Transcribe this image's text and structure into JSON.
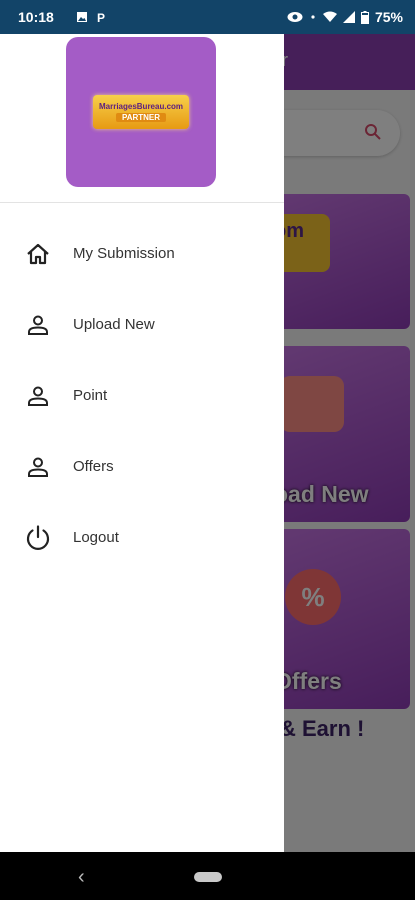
{
  "status_bar": {
    "time": "10:18",
    "battery": "75%"
  },
  "background_app": {
    "header_fragment": "r",
    "cards": [
      {
        "logo_fragment": "om"
      },
      {
        "label_fragment": "oad New"
      },
      {
        "label_fragment": "Offers"
      }
    ],
    "earn_fragment": "& Earn !"
  },
  "drawer": {
    "brand": {
      "line1": "MarriagesBureau.com",
      "line2": "PARTNER"
    },
    "menu": [
      {
        "label": "My Submission",
        "icon": "home-icon"
      },
      {
        "label": "Upload New",
        "icon": "person-icon"
      },
      {
        "label": "Point",
        "icon": "person-icon"
      },
      {
        "label": "Offers",
        "icon": "person-icon"
      },
      {
        "label": "Logout",
        "icon": "power-icon"
      }
    ]
  },
  "colors": {
    "status_bar": "#124468",
    "brand_purple": "#a45cc6",
    "brand_gold": "#f7d04a"
  }
}
